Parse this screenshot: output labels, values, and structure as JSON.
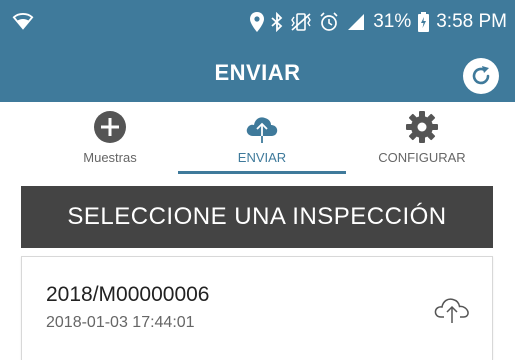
{
  "status_bar": {
    "battery": "31%",
    "time": "3:58 PM",
    "icons": [
      "wifi-icon",
      "location-icon",
      "bluetooth-icon",
      "vibrate-icon",
      "alarm-icon",
      "signal-icon",
      "battery-icon"
    ]
  },
  "app_bar": {
    "title": "ENVIAR",
    "refresh_icon": "refresh-icon"
  },
  "tabs": [
    {
      "label": "Muestras",
      "icon": "add-circle-icon",
      "active": false
    },
    {
      "label": "ENVIAR",
      "icon": "cloud-upload-icon",
      "active": true
    },
    {
      "label": "CONFIGURAR",
      "icon": "gear-icon",
      "active": false
    }
  ],
  "banner": {
    "text": "SELECCIONE UNA INSPECCIÓN"
  },
  "inspections": [
    {
      "code": "2018/M00000006",
      "date": "2018-01-03 17:44:01",
      "icon": "cloud-upload-icon"
    }
  ],
  "colors": {
    "primary": "#3f7a9b",
    "banner_bg": "#444444",
    "inactive_icon": "#555555"
  }
}
